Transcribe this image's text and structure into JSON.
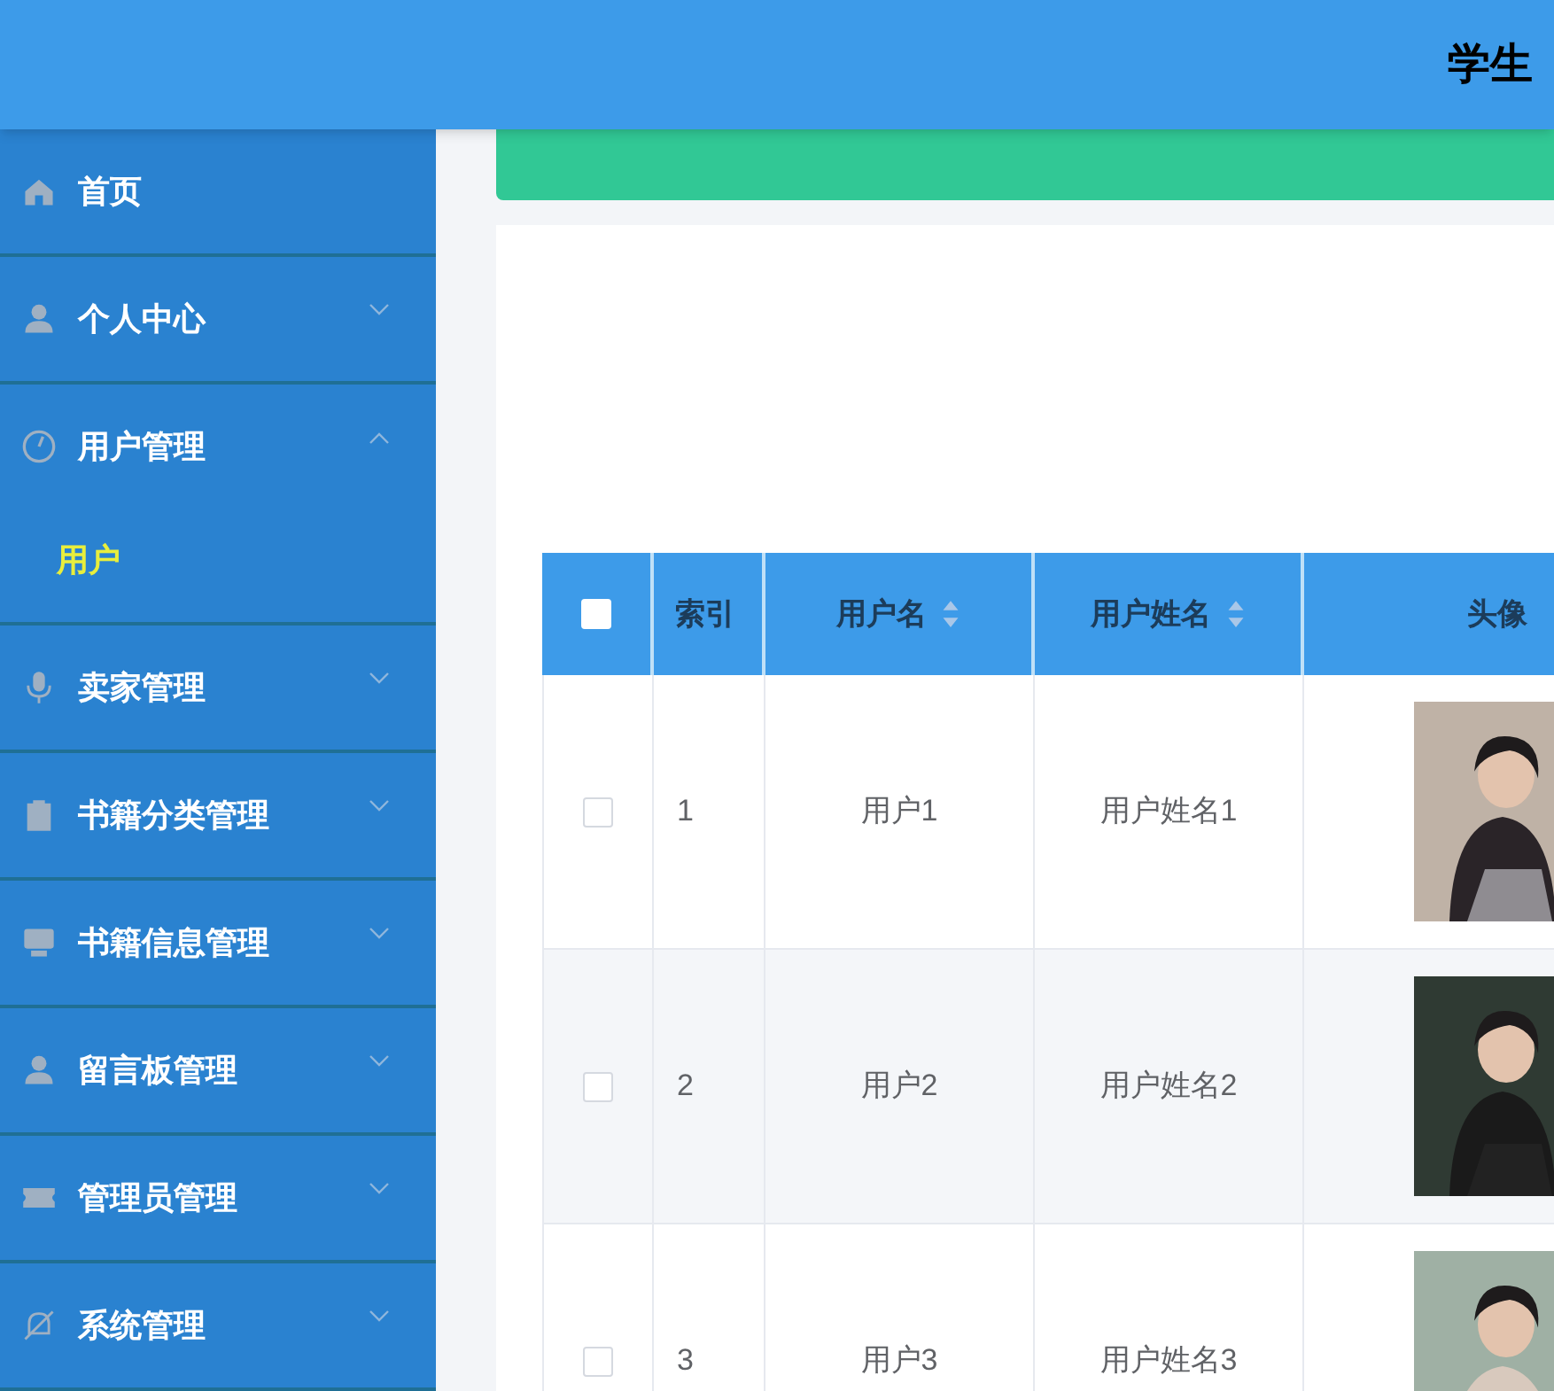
{
  "header": {
    "title": "学生"
  },
  "sidebar": {
    "items": [
      {
        "label": "首页",
        "kind": "link"
      },
      {
        "label": "个人中心",
        "kind": "menu",
        "expanded": false
      },
      {
        "label": "用户管理",
        "kind": "menu",
        "expanded": true,
        "children": [
          {
            "label": "用户",
            "selected": true
          }
        ]
      },
      {
        "label": "卖家管理",
        "kind": "menu",
        "expanded": false
      },
      {
        "label": "书籍分类管理",
        "kind": "menu",
        "expanded": false
      },
      {
        "label": "书籍信息管理",
        "kind": "menu",
        "expanded": false
      },
      {
        "label": "留言板管理",
        "kind": "menu",
        "expanded": false
      },
      {
        "label": "管理员管理",
        "kind": "menu",
        "expanded": false
      },
      {
        "label": "系统管理",
        "kind": "menu",
        "expanded": false
      }
    ]
  },
  "table": {
    "select_all": {
      "checked": false
    },
    "columns": [
      {
        "label": "索引",
        "sortable": false
      },
      {
        "label": "用户名",
        "sortable": true
      },
      {
        "label": "用户姓名",
        "sortable": true
      },
      {
        "label": "头像",
        "sortable": false
      }
    ],
    "rows": [
      {
        "checked": false,
        "index": "1",
        "username": "用户1",
        "name": "用户姓名1"
      },
      {
        "checked": false,
        "index": "2",
        "username": "用户2",
        "name": "用户姓名2"
      },
      {
        "checked": false,
        "index": "3",
        "username": "用户3",
        "name": "用户姓名3"
      }
    ]
  }
}
